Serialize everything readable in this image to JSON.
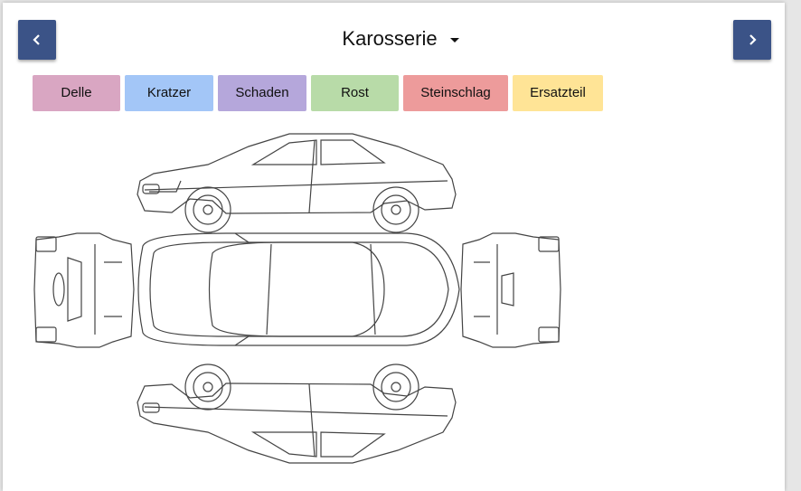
{
  "header": {
    "title": "Karosserie",
    "prev_icon": "chevron-left-icon",
    "next_icon": "chevron-right-icon",
    "dropdown_icon": "caret-down-icon"
  },
  "damage_types": [
    {
      "label": "Delle",
      "color": "#d9a6c2"
    },
    {
      "label": "Kratzer",
      "color": "#a3c6f7"
    },
    {
      "label": "Schaden",
      "color": "#b5a7db"
    },
    {
      "label": "Rost",
      "color": "#b8dba8"
    },
    {
      "label": "Steinschlag",
      "color": "#ed9b9b"
    },
    {
      "label": "Ersatzteil",
      "color": "#ffe496"
    }
  ],
  "colors": {
    "nav_button": "#3b5387"
  }
}
